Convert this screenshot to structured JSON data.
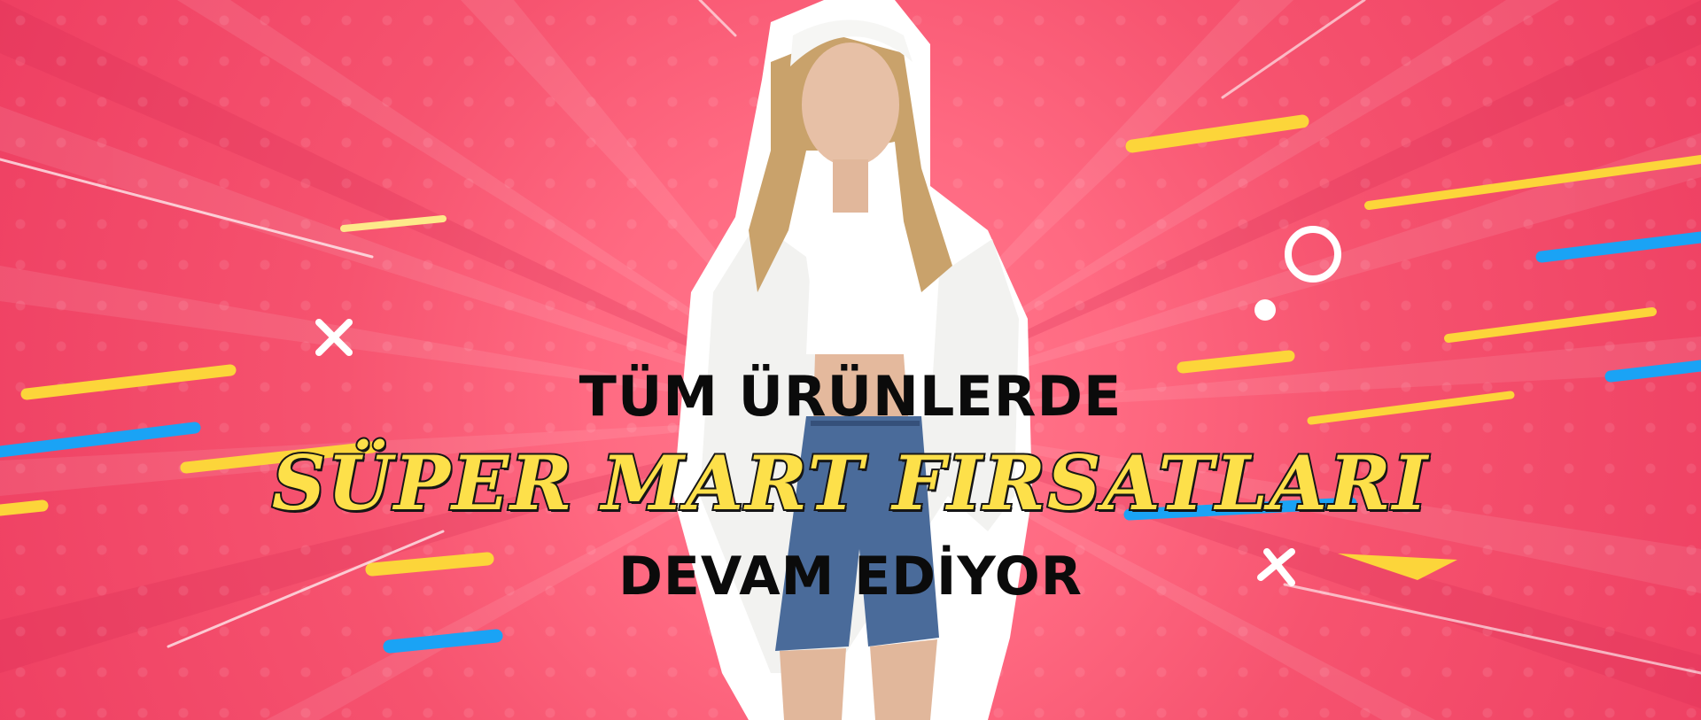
{
  "banner": {
    "line1": "TÜM ÜRÜNLERDE",
    "line2": "SÜPER MART FIRSATLARI",
    "line3": "DEVAM EDİYOR"
  },
  "colors": {
    "background": "#f7506e",
    "accent_yellow": "#fde04a",
    "accent_blue": "#1aa3f5",
    "text_dark": "#0b0b0b"
  },
  "icons": [
    "cross-icon",
    "ring-icon",
    "dot-icon"
  ]
}
